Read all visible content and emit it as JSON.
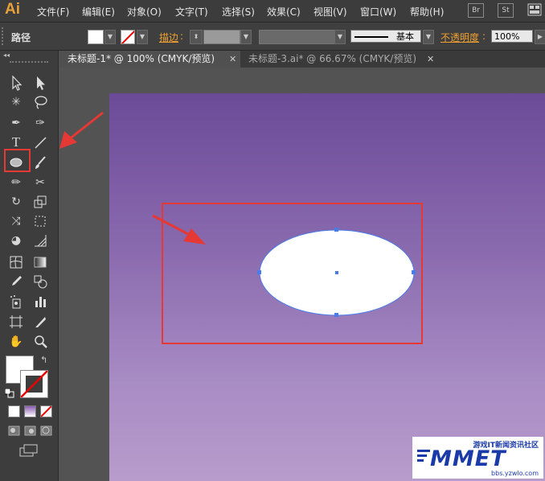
{
  "app": {
    "logo": "Ai"
  },
  "menu": [
    "文件(F)",
    "编辑(E)",
    "对象(O)",
    "文字(T)",
    "选择(S)",
    "效果(C)",
    "视图(V)",
    "窗口(W)",
    "帮助(H)"
  ],
  "menu_buttons": [
    "Br",
    "St"
  ],
  "control_bar": {
    "path_label": "路径",
    "stroke_label": "描边",
    "stroke_profile": "基本",
    "opacity_label": "不透明度",
    "opacity_value": "100%"
  },
  "tabs": [
    {
      "label": "未标题-1* @ 100% (CMYK/预览)",
      "active": true
    },
    {
      "label": "未标题-3.ai* @ 66.67% (CMYK/预览)",
      "active": false
    }
  ],
  "toolbox": {
    "collapse_glyph": "◂◂"
  },
  "watermark": {
    "top_text": "游戏IT新闻资讯社区",
    "main_text": "MMET",
    "url": "bbs.yzwlo.com"
  },
  "colors": {
    "accent_red": "#e53935",
    "orange_label": "#f0a030",
    "selection_blue": "#4a7ce8",
    "artboard_top": "#6b4a98",
    "artboard_bottom": "#b89ccc"
  }
}
